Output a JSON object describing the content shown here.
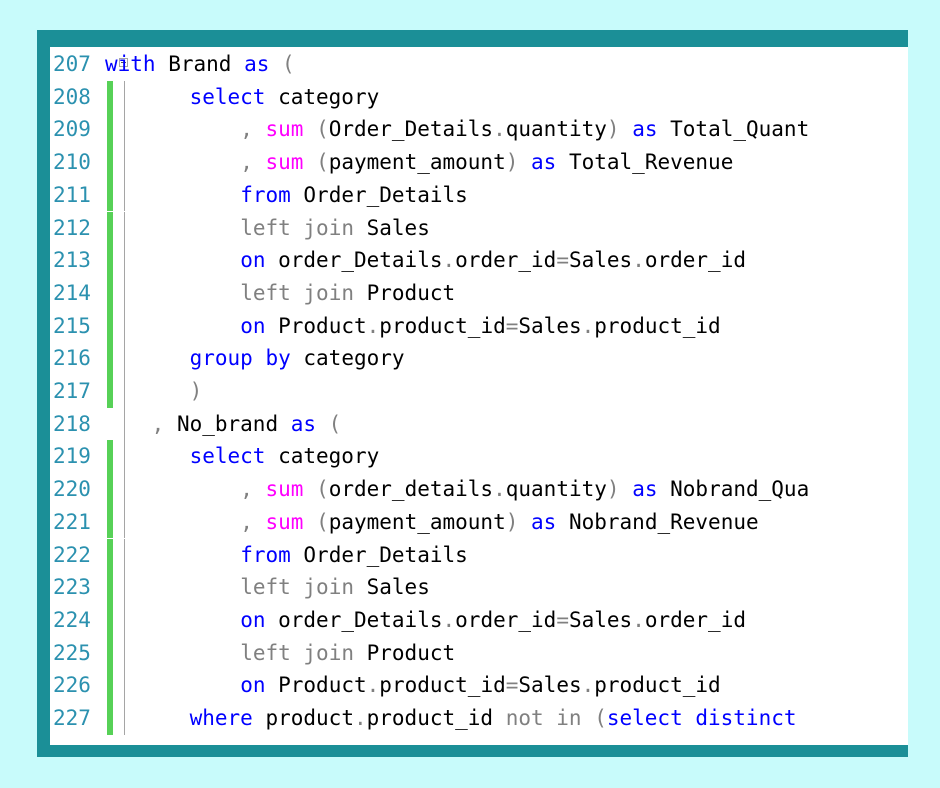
{
  "editor": {
    "colors": {
      "line_number": "#2b91af",
      "keyword": "#0000ff",
      "function": "#ff00ff",
      "operator": "#808080",
      "identifier": "#000000",
      "change_bar": "#57d157",
      "frame": "#1b8f97",
      "page_background": "#c8fbfb"
    },
    "lines": [
      {
        "num": "207",
        "bar": false,
        "fold": true,
        "indent": 0,
        "tokens": [
          {
            "t": "kw",
            "v": "with"
          },
          {
            "t": "id",
            "v": " Brand "
          },
          {
            "t": "kw",
            "v": "as"
          },
          {
            "t": "gr",
            "v": " ("
          }
        ]
      },
      {
        "num": "208",
        "bar": true,
        "fold": false,
        "indent": 4,
        "tokens": [
          {
            "t": "kw",
            "v": "select"
          },
          {
            "t": "id",
            "v": " category"
          }
        ]
      },
      {
        "num": "209",
        "bar": true,
        "fold": false,
        "indent": 8,
        "tokens": [
          {
            "t": "gr",
            "v": ", "
          },
          {
            "t": "fn",
            "v": "sum"
          },
          {
            "t": "gr",
            "v": " ("
          },
          {
            "t": "id",
            "v": "Order_Details"
          },
          {
            "t": "gr",
            "v": "."
          },
          {
            "t": "id",
            "v": "quantity"
          },
          {
            "t": "gr",
            "v": ")"
          },
          {
            "t": "kw",
            "v": " as"
          },
          {
            "t": "id",
            "v": " Total_Quant"
          }
        ]
      },
      {
        "num": "210",
        "bar": true,
        "fold": false,
        "indent": 8,
        "tokens": [
          {
            "t": "gr",
            "v": ", "
          },
          {
            "t": "fn",
            "v": "sum"
          },
          {
            "t": "gr",
            "v": " ("
          },
          {
            "t": "id",
            "v": "payment_amount"
          },
          {
            "t": "gr",
            "v": ")"
          },
          {
            "t": "kw",
            "v": " as"
          },
          {
            "t": "id",
            "v": " Total_Revenue"
          }
        ]
      },
      {
        "num": "211",
        "bar": true,
        "fold": false,
        "indent": 8,
        "tokens": [
          {
            "t": "kw",
            "v": "from"
          },
          {
            "t": "id",
            "v": " Order_Details"
          }
        ]
      },
      {
        "num": "212",
        "bar": true,
        "fold": false,
        "indent": 8,
        "tokens": [
          {
            "t": "gr",
            "v": "left join"
          },
          {
            "t": "id",
            "v": " Sales"
          }
        ]
      },
      {
        "num": "213",
        "bar": true,
        "fold": false,
        "indent": 8,
        "tokens": [
          {
            "t": "kw",
            "v": "on"
          },
          {
            "t": "id",
            "v": " order_Details"
          },
          {
            "t": "gr",
            "v": "."
          },
          {
            "t": "id",
            "v": "order_id"
          },
          {
            "t": "gr",
            "v": "="
          },
          {
            "t": "id",
            "v": "Sales"
          },
          {
            "t": "gr",
            "v": "."
          },
          {
            "t": "id",
            "v": "order_id"
          }
        ]
      },
      {
        "num": "214",
        "bar": true,
        "fold": false,
        "indent": 8,
        "tokens": [
          {
            "t": "gr",
            "v": "left join"
          },
          {
            "t": "id",
            "v": " Product"
          }
        ]
      },
      {
        "num": "215",
        "bar": true,
        "fold": false,
        "indent": 8,
        "tokens": [
          {
            "t": "kw",
            "v": "on"
          },
          {
            "t": "id",
            "v": " Product"
          },
          {
            "t": "gr",
            "v": "."
          },
          {
            "t": "id",
            "v": "product_id"
          },
          {
            "t": "gr",
            "v": "="
          },
          {
            "t": "id",
            "v": "Sales"
          },
          {
            "t": "gr",
            "v": "."
          },
          {
            "t": "id",
            "v": "product_id"
          }
        ]
      },
      {
        "num": "216",
        "bar": true,
        "fold": false,
        "indent": 4,
        "tokens": [
          {
            "t": "kw",
            "v": "group by"
          },
          {
            "t": "id",
            "v": " category"
          }
        ]
      },
      {
        "num": "217",
        "bar": true,
        "fold": false,
        "indent": 4,
        "tokens": [
          {
            "t": "gr",
            "v": ")"
          }
        ]
      },
      {
        "num": "218",
        "bar": false,
        "fold": false,
        "indent": 1,
        "tokens": [
          {
            "t": "gr",
            "v": ", "
          },
          {
            "t": "id",
            "v": "No_brand "
          },
          {
            "t": "kw",
            "v": "as"
          },
          {
            "t": "gr",
            "v": " ("
          }
        ]
      },
      {
        "num": "219",
        "bar": true,
        "fold": false,
        "indent": 4,
        "tokens": [
          {
            "t": "kw",
            "v": "select"
          },
          {
            "t": "id",
            "v": " category"
          }
        ]
      },
      {
        "num": "220",
        "bar": true,
        "fold": false,
        "indent": 8,
        "tokens": [
          {
            "t": "gr",
            "v": ", "
          },
          {
            "t": "fn",
            "v": "sum"
          },
          {
            "t": "gr",
            "v": " ("
          },
          {
            "t": "id",
            "v": "order_details"
          },
          {
            "t": "gr",
            "v": "."
          },
          {
            "t": "id",
            "v": "quantity"
          },
          {
            "t": "gr",
            "v": ")"
          },
          {
            "t": "kw",
            "v": " as"
          },
          {
            "t": "id",
            "v": " Nobrand_Qua"
          }
        ]
      },
      {
        "num": "221",
        "bar": true,
        "fold": false,
        "indent": 8,
        "tokens": [
          {
            "t": "gr",
            "v": ", "
          },
          {
            "t": "fn",
            "v": "sum"
          },
          {
            "t": "gr",
            "v": " ("
          },
          {
            "t": "id",
            "v": "payment_amount"
          },
          {
            "t": "gr",
            "v": ")"
          },
          {
            "t": "kw",
            "v": " as"
          },
          {
            "t": "id",
            "v": " Nobrand_Revenue"
          }
        ]
      },
      {
        "num": "222",
        "bar": true,
        "fold": false,
        "indent": 8,
        "tokens": [
          {
            "t": "kw",
            "v": "from"
          },
          {
            "t": "id",
            "v": " Order_Details"
          }
        ]
      },
      {
        "num": "223",
        "bar": true,
        "fold": false,
        "indent": 8,
        "tokens": [
          {
            "t": "gr",
            "v": "left join"
          },
          {
            "t": "id",
            "v": " Sales"
          }
        ]
      },
      {
        "num": "224",
        "bar": true,
        "fold": false,
        "indent": 8,
        "tokens": [
          {
            "t": "kw",
            "v": "on"
          },
          {
            "t": "id",
            "v": " order_Details"
          },
          {
            "t": "gr",
            "v": "."
          },
          {
            "t": "id",
            "v": "order_id"
          },
          {
            "t": "gr",
            "v": "="
          },
          {
            "t": "id",
            "v": "Sales"
          },
          {
            "t": "gr",
            "v": "."
          },
          {
            "t": "id",
            "v": "order_id"
          }
        ]
      },
      {
        "num": "225",
        "bar": true,
        "fold": false,
        "indent": 8,
        "tokens": [
          {
            "t": "gr",
            "v": "left join"
          },
          {
            "t": "id",
            "v": " Product"
          }
        ]
      },
      {
        "num": "226",
        "bar": true,
        "fold": false,
        "indent": 8,
        "tokens": [
          {
            "t": "kw",
            "v": "on"
          },
          {
            "t": "id",
            "v": " Product"
          },
          {
            "t": "gr",
            "v": "."
          },
          {
            "t": "id",
            "v": "product_id"
          },
          {
            "t": "gr",
            "v": "="
          },
          {
            "t": "id",
            "v": "Sales"
          },
          {
            "t": "gr",
            "v": "."
          },
          {
            "t": "id",
            "v": "product_id"
          }
        ]
      },
      {
        "num": "227",
        "bar": true,
        "fold": false,
        "indent": 4,
        "tokens": [
          {
            "t": "kw",
            "v": "where"
          },
          {
            "t": "id",
            "v": " product"
          },
          {
            "t": "gr",
            "v": "."
          },
          {
            "t": "id",
            "v": "product_id"
          },
          {
            "t": "gr",
            "v": " not in ("
          },
          {
            "t": "kw",
            "v": "select distinct"
          }
        ]
      }
    ]
  }
}
